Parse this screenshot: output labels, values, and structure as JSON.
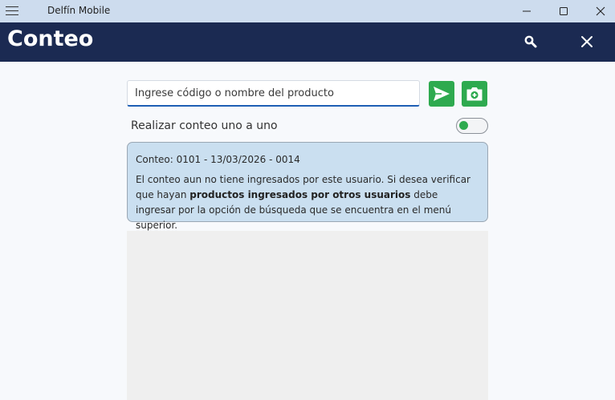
{
  "window": {
    "title": "Delfín Mobile",
    "controls": {
      "minimize": "minimize-icon",
      "maximize": "maximize-icon",
      "close": "close-icon"
    }
  },
  "header": {
    "title": "Conteo",
    "icons": {
      "search": "search-icon",
      "close": "close-icon"
    }
  },
  "search": {
    "placeholder": "Ingrese código o nombre del producto",
    "value": ""
  },
  "actions": {
    "send_icon": "send-icon",
    "camera_icon": "camera-icon"
  },
  "toggle": {
    "label": "Realizar conteo uno a uno",
    "on": true
  },
  "info": {
    "heading": "Conteo: 0101 - 13/03/2026 - 0014",
    "text_before": "El conteo aun no tiene ingresados por este usuario. Si desea verificar que hayan ",
    "text_bold": "productos ingresados por otros usuarios",
    "text_after": " debe ingresar por la opción de búsqueda que se encuentra en el menú superior."
  },
  "colors": {
    "titlebar": "#cddcee",
    "header": "#1b2a52",
    "accent_green": "#2eaa4f",
    "input_focus": "#1e5fb4",
    "info_card": "#cadff0"
  }
}
